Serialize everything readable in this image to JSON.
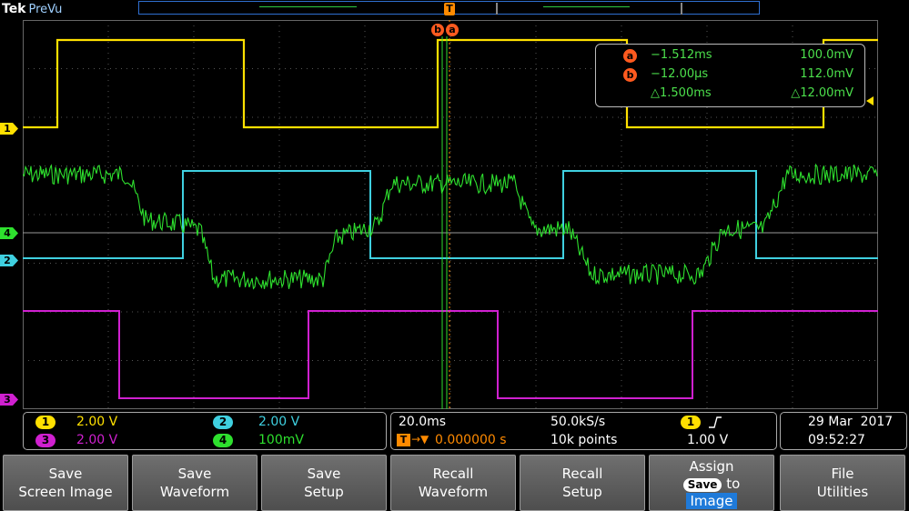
{
  "header": {
    "brand": "Tek",
    "model": "PreVu"
  },
  "trigger_marker": "T",
  "cursor_tags": [
    "b",
    "a"
  ],
  "channels": [
    {
      "id": "1",
      "color": "#ffe000"
    },
    {
      "id": "2",
      "color": "#3fd0e0"
    },
    {
      "id": "3",
      "color": "#d020d0"
    },
    {
      "id": "4",
      "color": "#2ee02e"
    }
  ],
  "cursor_readout": {
    "a": {
      "label": "a",
      "time": "−1.512ms",
      "value": "100.0mV"
    },
    "b": {
      "label": "b",
      "time": "−12.00µs",
      "value": "112.0mV"
    },
    "delta": {
      "time": "△1.500ms",
      "value": "△12.00mV"
    }
  },
  "vertical": [
    {
      "ch": "1",
      "scale": "2.00 V",
      "color": "#ffe000"
    },
    {
      "ch": "2",
      "scale": "2.00 V",
      "color": "#3fd0e0"
    },
    {
      "ch": "3",
      "scale": "2.00 V",
      "color": "#d020d0"
    },
    {
      "ch": "4",
      "scale": "100mV",
      "color": "#2ee02e"
    }
  ],
  "horizontal": {
    "timebase": "20.0ms",
    "sample_rate": "50.0kS/s",
    "trigger_delay": "0.000000 s",
    "record_length": "10k points",
    "trigger_source": "1",
    "trigger_level": "1.00 V",
    "trigger_slope_icon": "rising-edge-icon"
  },
  "datetime": {
    "date": "29 Mar  2017",
    "time": "09:52:27"
  },
  "menu": [
    {
      "l1": "Save",
      "l2": "Screen Image"
    },
    {
      "l1": "Save",
      "l2": "Waveform"
    },
    {
      "l1": "Save",
      "l2": "Setup"
    },
    {
      "l1": "Recall",
      "l2": "Waveform"
    },
    {
      "l1": "Recall",
      "l2": "Setup"
    },
    {
      "l1": "Assign",
      "save_pill": "Save",
      "to": "to",
      "selected": "Image"
    },
    {
      "l1": "File",
      "l2": "Utilities"
    }
  ]
}
